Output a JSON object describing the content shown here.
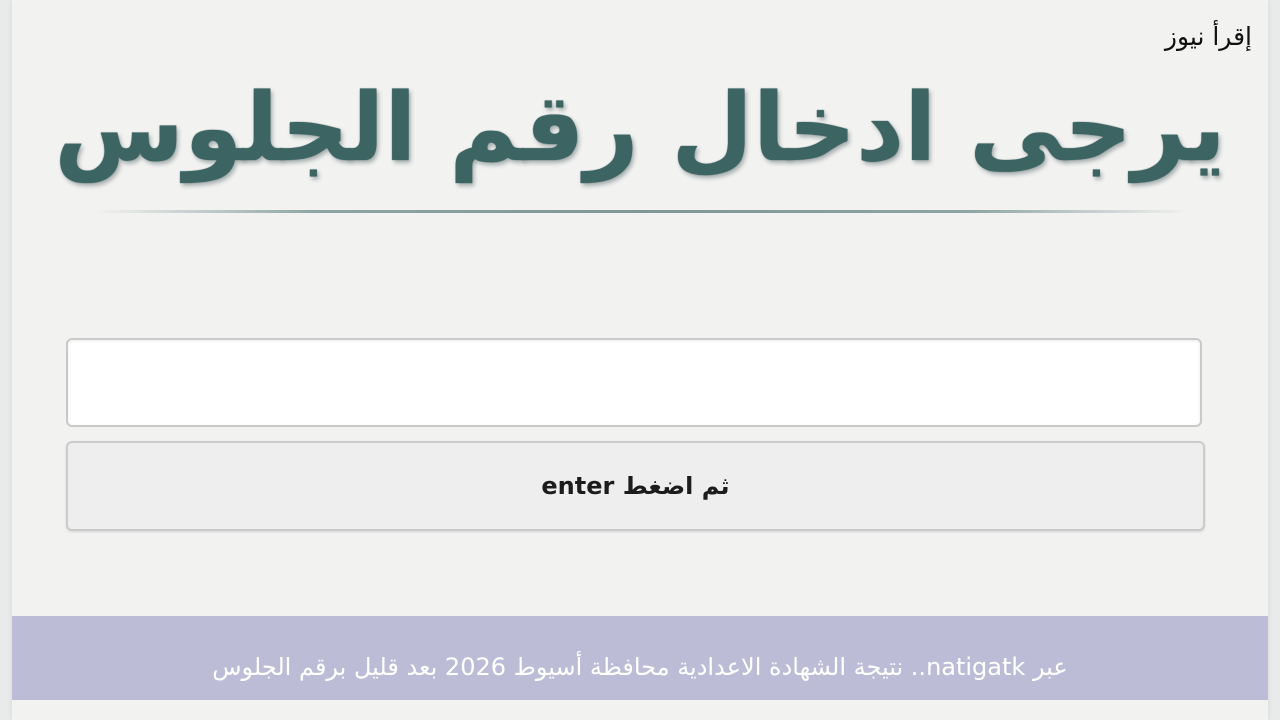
{
  "brand": {
    "name": "إقرأ نيوز"
  },
  "page": {
    "headline": "يرجى ادخال رقم الجلوس"
  },
  "form": {
    "seat_input_value": "",
    "enter_button_label": "ثم اضغط enter"
  },
  "caption": {
    "text": "عبر natigatk.. نتيجة الشهادة الاعدادية محافظة أسيوط 2026 بعد قليل برقم الجلوس"
  },
  "colors": {
    "headline": "#3c6462",
    "caption_bar": "#bdbcd6",
    "background": "#f2f2f1"
  }
}
